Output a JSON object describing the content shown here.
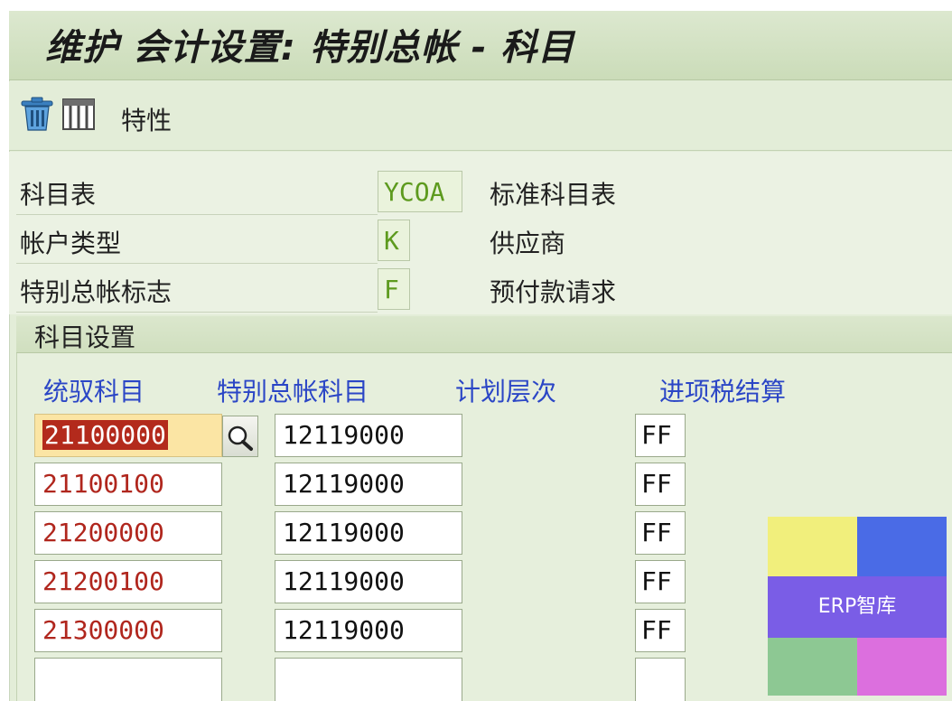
{
  "window": {
    "title": "维护 会计设置: 特别总帐 - 科目"
  },
  "toolbar": {
    "items": [
      {
        "icon": "trash-icon"
      },
      {
        "icon": "table-columns-icon"
      }
    ],
    "properties_label": "特性"
  },
  "header": {
    "fields": [
      {
        "label": "科目表",
        "value": "YCOA",
        "description": "标准科目表"
      },
      {
        "label": "帐户类型",
        "value": "K",
        "description": "供应商"
      },
      {
        "label": "特别总帐标志",
        "value": "F",
        "description": "预付款请求"
      }
    ]
  },
  "account_assignment": {
    "title": "科目设置",
    "columns": {
      "recon_account": "统驭科目",
      "special_gl_account": "特别总帐科目",
      "planning_level": "计划层次",
      "input_tax_clearing": "进项税结算"
    },
    "rows": [
      {
        "recon_account": "21100000",
        "special_gl_account": "12119000",
        "planning_level": "",
        "input_tax_clearing": "FF"
      },
      {
        "recon_account": "21100100",
        "special_gl_account": "12119000",
        "planning_level": "",
        "input_tax_clearing": "FF"
      },
      {
        "recon_account": "21200000",
        "special_gl_account": "12119000",
        "planning_level": "",
        "input_tax_clearing": "FF"
      },
      {
        "recon_account": "21200100",
        "special_gl_account": "12119000",
        "planning_level": "",
        "input_tax_clearing": "FF"
      },
      {
        "recon_account": "21300000",
        "special_gl_account": "12119000",
        "planning_level": "",
        "input_tax_clearing": "FF"
      },
      {
        "recon_account": "",
        "special_gl_account": "",
        "planning_level": "",
        "input_tax_clearing": ""
      }
    ],
    "value_help_icon": "magnifier-icon"
  },
  "watermark": {
    "text": "ERP智库",
    "colors": [
      "#f1ef7c",
      "#4a6be6",
      "#8dc893",
      "#dc6fde",
      "#7a5de6"
    ]
  },
  "colors": {
    "column_header": "#2b46c6",
    "account_text": "#b0261d",
    "key_value_text": "#5d9a1e",
    "focus_field": "#fbe5a4",
    "selection": "#b32a1c"
  }
}
